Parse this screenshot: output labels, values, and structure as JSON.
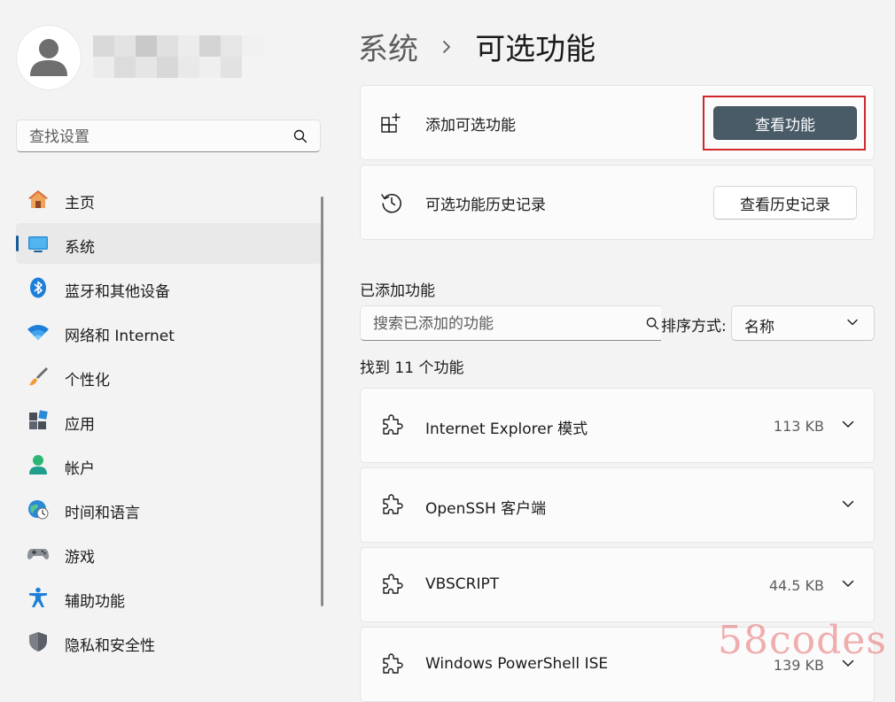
{
  "sidebar": {
    "search": {
      "placeholder": "查找设置"
    },
    "items": [
      {
        "label": "主页",
        "icon": "home-icon"
      },
      {
        "label": "系统",
        "icon": "system-icon",
        "active": true
      },
      {
        "label": "蓝牙和其他设备",
        "icon": "bluetooth-icon"
      },
      {
        "label": "网络和 Internet",
        "icon": "wifi-icon"
      },
      {
        "label": "个性化",
        "icon": "brush-icon"
      },
      {
        "label": "应用",
        "icon": "apps-icon"
      },
      {
        "label": "帐户",
        "icon": "account-icon"
      },
      {
        "label": "时间和语言",
        "icon": "time-language-icon"
      },
      {
        "label": "游戏",
        "icon": "gamepad-icon"
      },
      {
        "label": "辅助功能",
        "icon": "accessibility-icon"
      },
      {
        "label": "隐私和安全性",
        "icon": "shield-icon"
      }
    ]
  },
  "breadcrumb": {
    "parent": "系统",
    "current": "可选功能"
  },
  "add_feature": {
    "label": "添加可选功能",
    "button": "查看功能"
  },
  "history": {
    "label": "可选功能历史记录",
    "button": "查看历史记录"
  },
  "installed": {
    "title": "已添加功能",
    "search_placeholder": "搜索已添加的功能",
    "sort_label": "排序方式:",
    "sort_value": "名称",
    "found": "找到 11 个功能",
    "features": [
      {
        "name": "Internet Explorer 模式",
        "size": "113 KB"
      },
      {
        "name": "OpenSSH 客户端",
        "size": ""
      },
      {
        "name": "VBSCRIPT",
        "size": "44.5 KB"
      },
      {
        "name": "Windows PowerShell ISE",
        "size": "139 KB"
      }
    ]
  },
  "watermark": "58codes",
  "colors": {
    "accent": "#1a5c98",
    "primary_button": "#4a5b68",
    "highlight": "#d2262c",
    "background": "#f3f3f3",
    "card": "#fbfbfb"
  }
}
